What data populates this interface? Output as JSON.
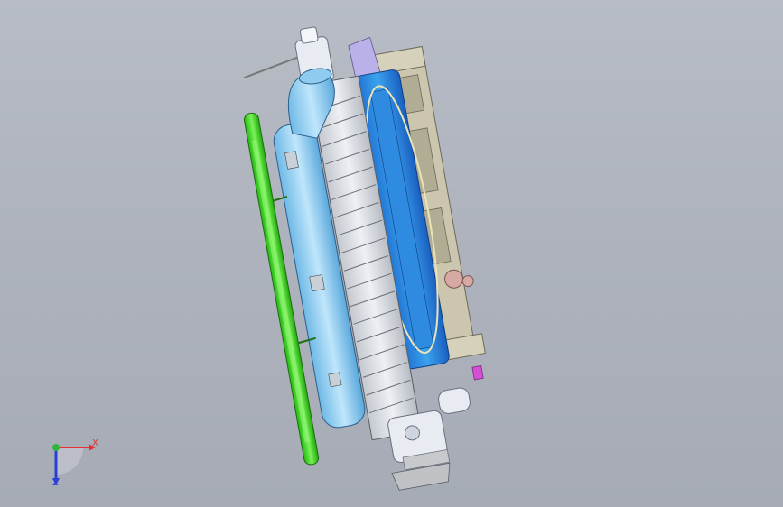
{
  "viewport": {
    "background_top": "#b7bcc5",
    "background_bottom": "#a6abb5"
  },
  "model": {
    "colors": {
      "green_pipe": "#3fdc22",
      "light_blue_tank": "#9fd6f2",
      "blue_body": "#2f8fe0",
      "dark_blue": "#1f66c9",
      "core_gray": "#d7d9dd",
      "bracket_tan": "#cbc6ad",
      "white_parts": "#e8ecf2",
      "lavender": "#b9b1e8",
      "magenta_clip": "#d54fd6",
      "pink_bolt": "#d7a9a4"
    }
  },
  "triad": {
    "x_label": "X",
    "z_label": "Z",
    "x_color": "#e53030",
    "z_color": "#2b3fd6",
    "y_color": "#2fb63a"
  }
}
